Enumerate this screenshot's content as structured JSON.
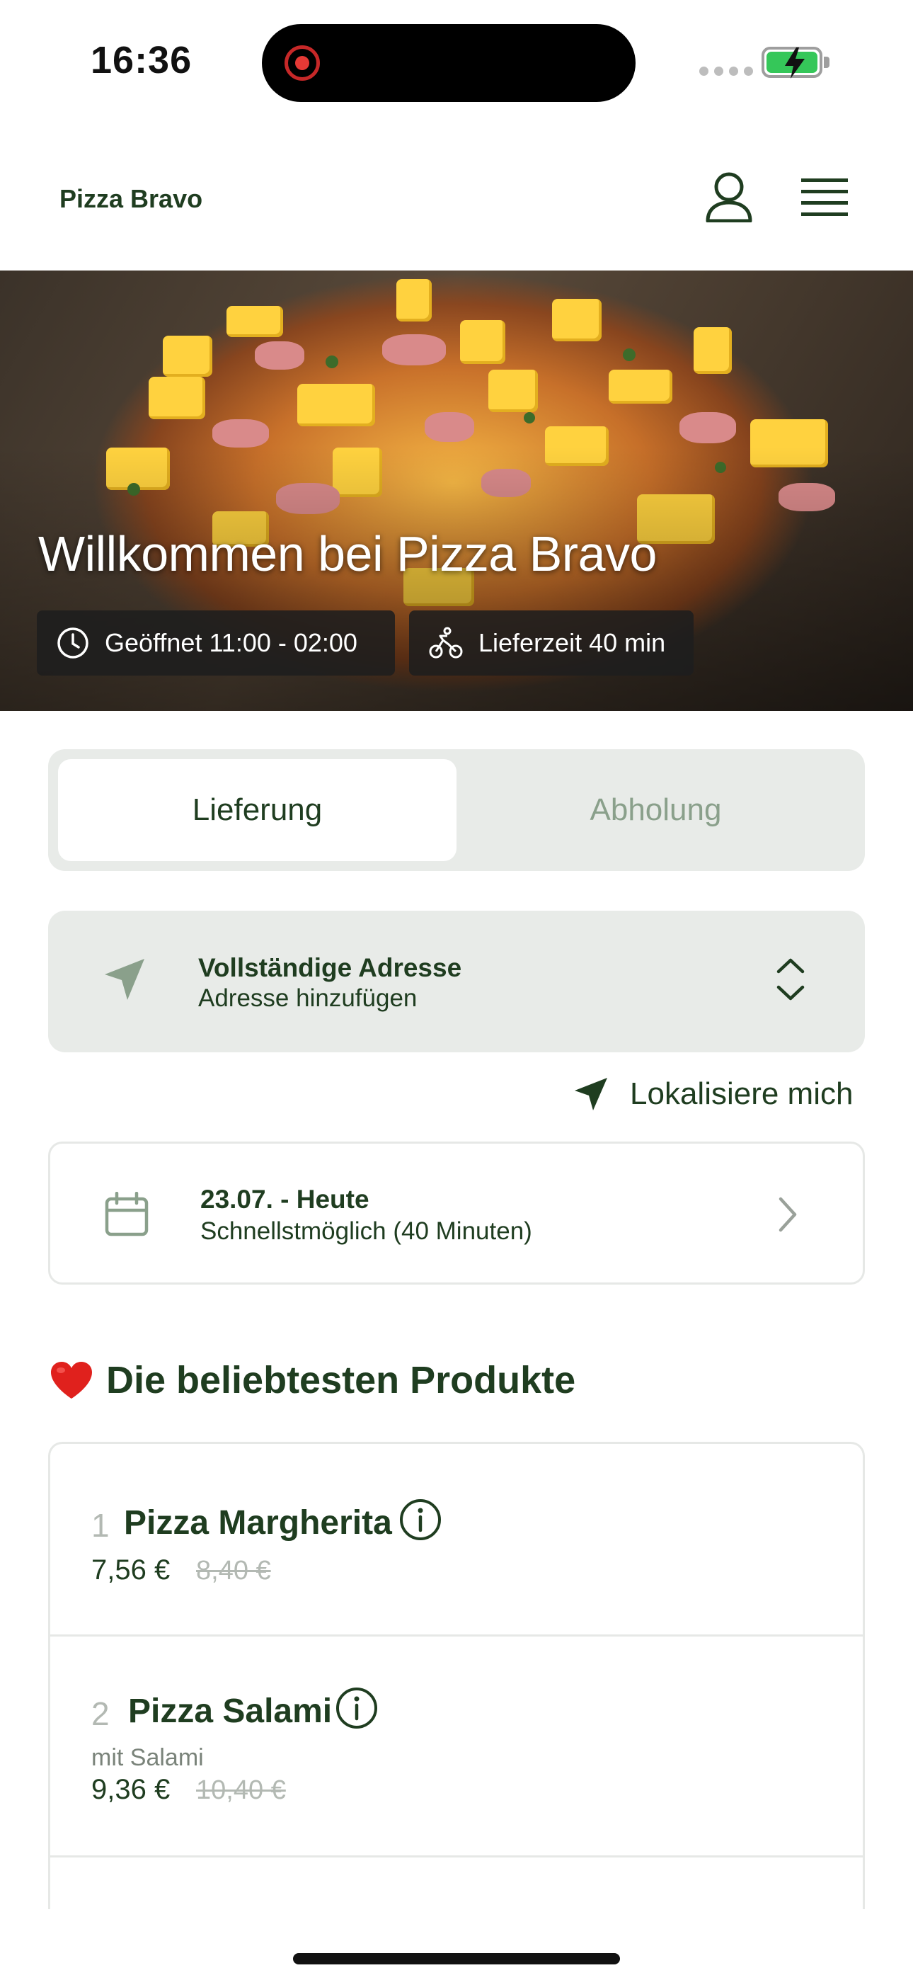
{
  "status_bar": {
    "time": "16:36"
  },
  "header": {
    "brand": "Pizza Bravo"
  },
  "hero": {
    "title": "Willkommen bei Pizza Bravo",
    "opening_hours": "Geöffnet 11:00 - 02:00",
    "delivery_time": "Lieferzeit 40 min"
  },
  "tabs": [
    {
      "label": "Lieferung",
      "active": true
    },
    {
      "label": "Abholung",
      "active": false
    }
  ],
  "address": {
    "title": "Vollständige Adresse",
    "subtitle": "Adresse hinzufügen"
  },
  "locate": {
    "label": "Lokalisiere mich"
  },
  "schedule": {
    "title": "23.07. - Heute",
    "subtitle": "Schnellstmöglich (40 Minuten)"
  },
  "popular": {
    "emoji": "❤️",
    "title": "Die beliebtesten Produkte",
    "items": [
      {
        "rank": "1",
        "name": "Pizza Margherita",
        "description": "",
        "price": "7,56 €",
        "old_price": "8,40 €"
      },
      {
        "rank": "2",
        "name": "Pizza Salami",
        "description": "mit Salami",
        "price": "9,36 €",
        "old_price": "10,40 €"
      }
    ]
  },
  "colors": {
    "primary": "#1f3d20",
    "muted": "#8aa08b",
    "panel": "#e8ebe8",
    "battery": "#35c759"
  },
  "icons": [
    "user-icon",
    "menu-icon",
    "clock-icon",
    "bicycle-icon",
    "navigation-arrow-icon",
    "chevron-up-down-icon",
    "calendar-icon",
    "chevron-right-icon",
    "info-icon",
    "heart-icon"
  ]
}
